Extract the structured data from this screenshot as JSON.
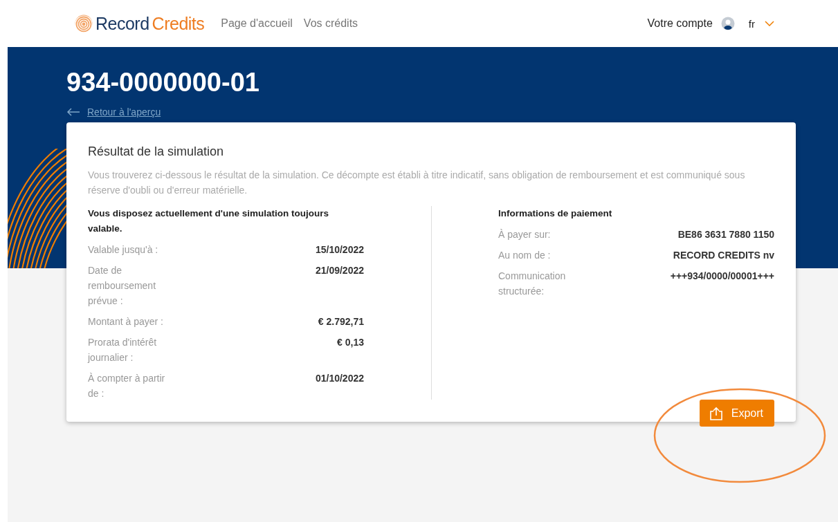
{
  "header": {
    "logo": {
      "part_1": "Record",
      "part_2": "Credits"
    },
    "nav": [
      {
        "label": "Page d'accueil",
        "selected": false
      },
      {
        "label": "Vos crédits",
        "selected": false
      }
    ],
    "account": "Votre compte",
    "language": "fr"
  },
  "page": {
    "title": "934-0000000-01",
    "back_link": "Retour à l'aperçu"
  },
  "card": {
    "title": "Résultat de la simulation",
    "description": "Vous trouverez ci-dessous le résultat de la simulation. Ce décompte est établi à titre indicatif, sans obligation de remboursement et est communiqué sous réserve d'oubli ou d'erreur matérielle.",
    "simulation": {
      "heading": "Vous disposez actuellement d'une simulation toujours valable.",
      "rows": [
        {
          "label": "Valable jusqu'à :",
          "value": "15/10/2022"
        },
        {
          "label": "Date de remboursement prévue :",
          "value": "21/09/2022"
        },
        {
          "label": "Montant à payer :",
          "value": "€ 2.792,71"
        },
        {
          "label": "Prorata d'intérêt journalier :",
          "value": "€ 0,13"
        },
        {
          "label": "À compter à partir de :",
          "value": "01/10/2022"
        }
      ]
    },
    "payment": {
      "heading": "Informations de paiement",
      "rows": [
        {
          "label": "À payer sur:",
          "value": "BE86 3631 7880 1150"
        },
        {
          "label": "Au nom de :",
          "value": "RECORD CREDITS nv"
        },
        {
          "label": "Communication structurée:",
          "value": "+++934/0000/00001+++"
        }
      ]
    },
    "export_button": "Export"
  }
}
